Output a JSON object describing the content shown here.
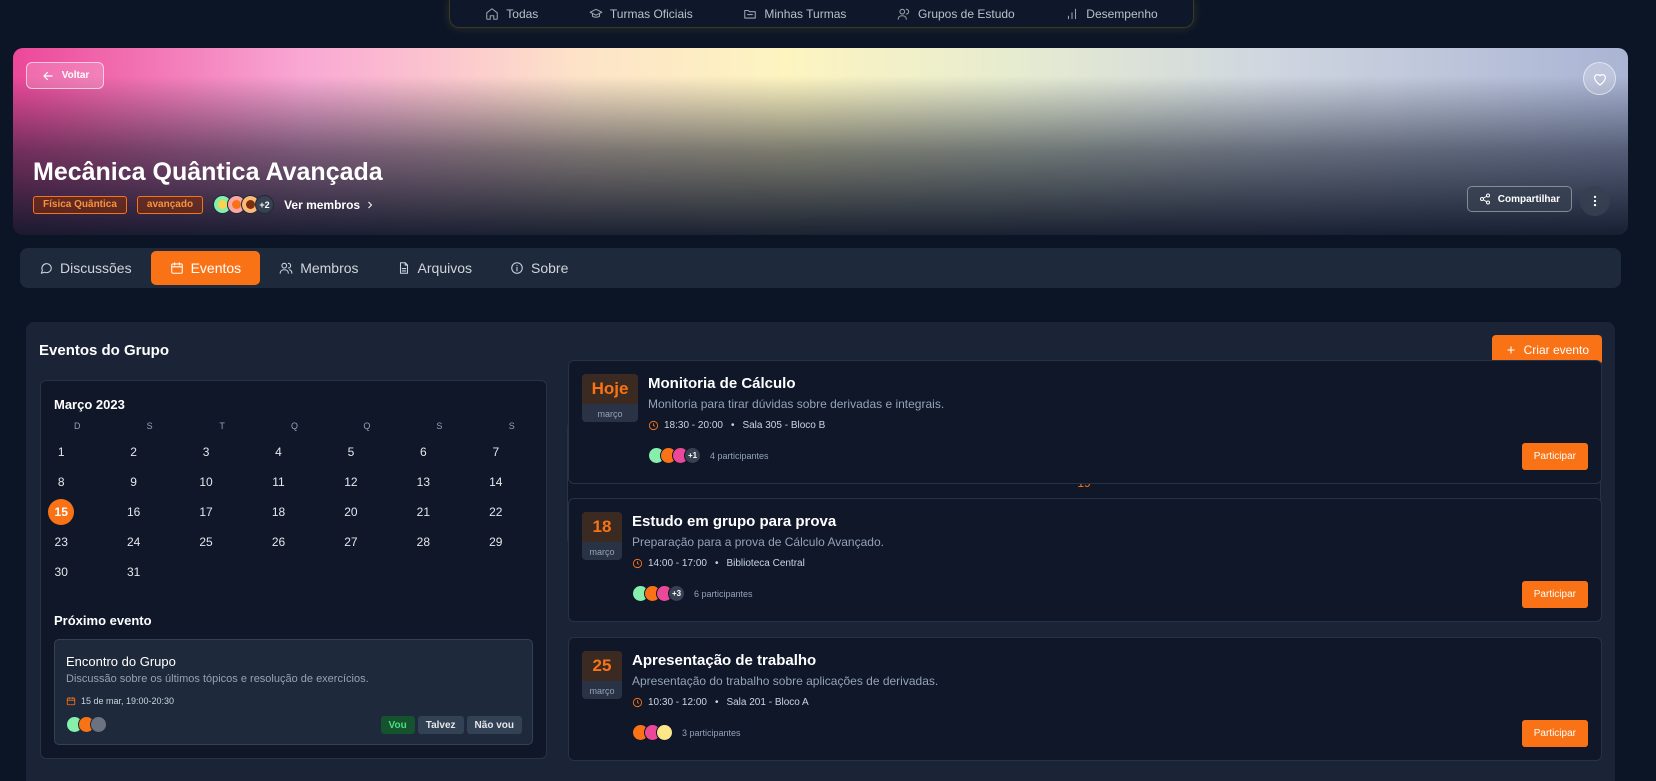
{
  "topnav": {
    "items": [
      {
        "label": "Todas",
        "icon": "home-icon"
      },
      {
        "label": "Turmas Oficiais",
        "icon": "graduation-cap-icon"
      },
      {
        "label": "Minhas Turmas",
        "icon": "folder-icon"
      },
      {
        "label": "Grupos de Estudo",
        "icon": "users-icon"
      },
      {
        "label": "Desempenho",
        "icon": "bar-chart-icon"
      }
    ]
  },
  "hero": {
    "back_label": "Voltar",
    "title": "Mecânica Quântica Avançada",
    "tags": [
      "Física Quântica",
      "avançado"
    ],
    "members_more": "+2",
    "members_link": "Ver membros",
    "share_label": "Compartilhar"
  },
  "tabs": [
    {
      "label": "Discussões",
      "icon": "message-circle-icon",
      "active": false
    },
    {
      "label": "Eventos",
      "icon": "calendar-icon",
      "active": true
    },
    {
      "label": "Membros",
      "icon": "users-icon",
      "active": false
    },
    {
      "label": "Arquivos",
      "icon": "file-icon",
      "active": false
    },
    {
      "label": "Sobre",
      "icon": "info-icon",
      "active": false
    }
  ],
  "panel": {
    "title": "Eventos do Grupo",
    "create_label": "Criar evento"
  },
  "calendar": {
    "month": "Março 2023",
    "weekdays": [
      "D",
      "S",
      "T",
      "Q",
      "Q",
      "S",
      "S"
    ],
    "days": [
      1,
      2,
      3,
      4,
      5,
      6,
      7,
      8,
      9,
      10,
      11,
      12,
      13,
      14,
      15,
      16,
      17,
      18,
      19,
      20,
      21,
      22,
      23,
      24,
      25,
      26,
      27,
      28,
      29,
      30,
      31
    ],
    "today": 15,
    "highlighted": [
      19
    ]
  },
  "next_event": {
    "section_title": "Próximo evento",
    "name": "Encontro do Grupo",
    "description": "Discussão sobre os últimos tópicos e resolução de exercícios.",
    "date": "15 de mar, 19:00-20:30",
    "rsvp": {
      "yes": "Vou",
      "maybe": "Talvez",
      "no": "Não vou"
    }
  },
  "events": [
    {
      "day": "Hoje",
      "month": "março",
      "title": "Monitoria de Cálculo",
      "description": "Monitoria para tirar dúvidas sobre derivadas e integrais.",
      "time": "18:30 - 20:00",
      "location": "Sala 305 - Bloco B",
      "avatar_more": "+1",
      "participants": "4 participantes",
      "join_label": "Participar"
    },
    {
      "day": "18",
      "month": "março",
      "title": "Estudo em grupo para prova",
      "description": "Preparação para a prova de Cálculo Avançado.",
      "time": "14:00 - 17:00",
      "location": "Biblioteca Central",
      "avatar_more": "+3",
      "participants": "6 participantes",
      "join_label": "Participar"
    },
    {
      "day": "25",
      "month": "março",
      "title": "Apresentação de trabalho",
      "description": "Apresentação do trabalho sobre aplicações de derivadas.",
      "time": "10:30 - 12:00",
      "location": "Sala 201 - Bloco A",
      "avatar_more": "",
      "participants": "3 participantes",
      "join_label": "Participar"
    }
  ],
  "colors": {
    "accent": "#f97316",
    "background": "#0c1526",
    "panel": "#1a2436",
    "card": "#0f1729"
  }
}
